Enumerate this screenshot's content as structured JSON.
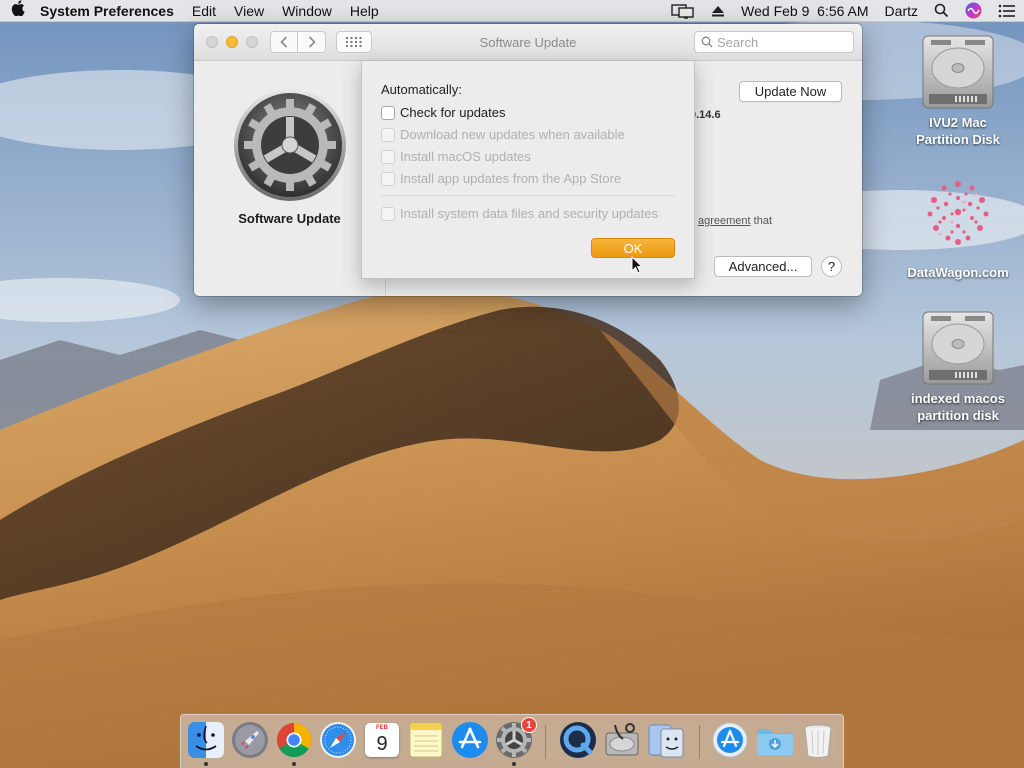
{
  "menubar": {
    "app_name": "System Preferences",
    "menus": [
      "Edit",
      "View",
      "Window",
      "Help"
    ],
    "datetime": "Wed Feb 9  6:56 AM",
    "user": "Dartz"
  },
  "window": {
    "title": "Software Update",
    "search_placeholder": "Search",
    "pane_name": "Software Update",
    "update_now_label": "Update Now",
    "version_fragment": "0.14.6",
    "agreement_link": "agreement",
    "agreement_rest": " that",
    "advanced_label": "Advanced...",
    "help_label": "?"
  },
  "sheet": {
    "heading": "Automatically:",
    "options": [
      {
        "label": "Check for updates",
        "enabled": true,
        "checked": false
      },
      {
        "label": "Download new updates when available",
        "enabled": false,
        "checked": false
      },
      {
        "label": "Install macOS updates",
        "enabled": false,
        "checked": false
      },
      {
        "label": "Install app updates from the App Store",
        "enabled": false,
        "checked": false
      },
      {
        "label": "Install system data files and security updates",
        "enabled": false,
        "checked": false
      }
    ],
    "ok_label": "OK"
  },
  "desktop": {
    "icons": [
      {
        "label_line1": "IVU2 Mac",
        "label_line2": "Partition Disk",
        "icon": "hard-drive-icon"
      },
      {
        "label_line1": "DataWagon.com",
        "label_line2": "",
        "icon": "pink-dots-icon"
      },
      {
        "label_line1": "indexed macos",
        "label_line2": "partition disk",
        "icon": "hard-drive-icon"
      }
    ]
  },
  "dock": {
    "calendar_month": "FEB",
    "calendar_day": "9",
    "sysprefs_badge": "1"
  },
  "colors": {
    "accent_button": "#ec9a12",
    "minimize_light": "#f5bd2f",
    "badge": "#e8453c"
  }
}
